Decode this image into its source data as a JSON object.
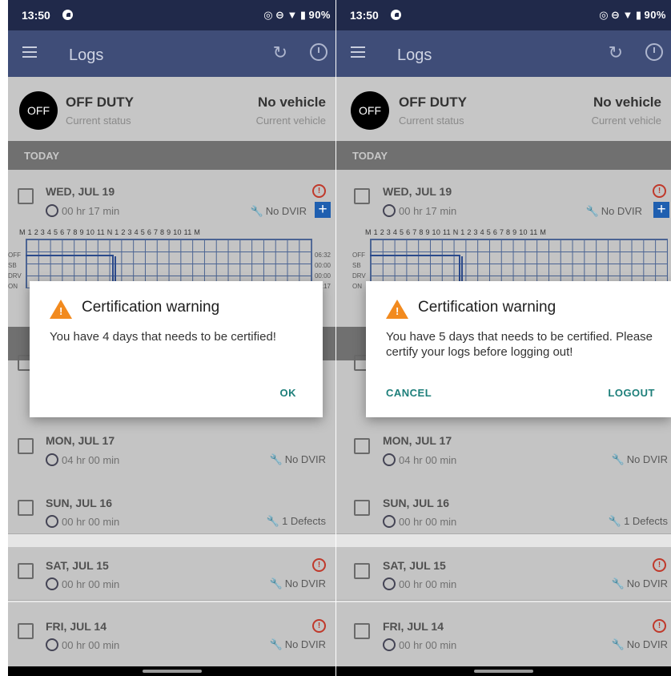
{
  "status_bar": {
    "time": "13:50",
    "battery": "90%"
  },
  "app_bar": {
    "title": "Logs"
  },
  "status": {
    "badge": "OFF",
    "duty": "OFF DUTY",
    "duty_sub": "Current status",
    "vehicle": "No vehicle",
    "vehicle_sub": "Current vehicle"
  },
  "today_header": "TODAY",
  "today": {
    "date": "WED, JUL 19",
    "duration": "00 hr 17 min",
    "dvir": "No DVIR",
    "hours_axis": "M 1 2 3 4 5 6 7 8 9 10 11 N 1 2 3 4 5 6 7 8 9 10 11 M",
    "rows": [
      {
        "label": "OFF",
        "total": "06:32"
      },
      {
        "label": "SB",
        "total": "00:00"
      },
      {
        "label": "DRV",
        "total": "00:00"
      },
      {
        "label": "ON",
        "total": "00:17"
      }
    ]
  },
  "days": [
    {
      "date": "MON, JUL 17",
      "duration": "04 hr 00 min",
      "dvir": "No DVIR",
      "alert": false
    },
    {
      "date": "SUN, JUL 16",
      "duration": "00 hr 00 min",
      "dvir": "1 Defects",
      "alert": false
    },
    {
      "date": "SAT, JUL 15",
      "duration": "00 hr 00 min",
      "dvir": "No DVIR",
      "alert": true
    },
    {
      "date": "FRI, JUL 14",
      "duration": "00 hr 00 min",
      "dvir": "No DVIR",
      "alert": true
    }
  ],
  "dialog1": {
    "title": "Certification warning",
    "message": "You have 4 days that needs to be certified!",
    "ok": "OK"
  },
  "dialog2": {
    "title": "Certification warning",
    "message": "You have 5 days that needs to be certified. Please certify your logs before logging out!",
    "cancel": "CANCEL",
    "logout": "LOGOUT"
  },
  "colors": {
    "status_bar": "#20294a",
    "app_bar": "#3f4d78",
    "warning": "#f28a1e",
    "dialog_button": "#1d7f7a"
  }
}
